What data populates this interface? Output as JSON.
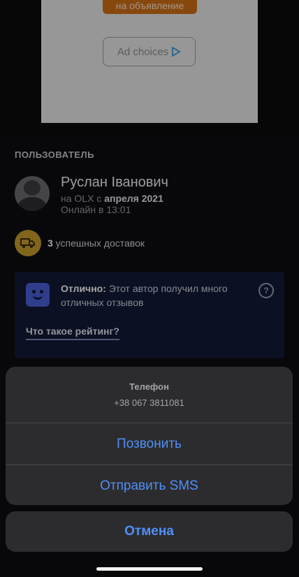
{
  "ad": {
    "report_label": "на объявление",
    "choices_label": "Ad choices"
  },
  "user_section": {
    "title": "ПОЛЬЗОВАТЕЛЬ",
    "name": "Руслан Іванович",
    "since_prefix": "на OLX с ",
    "since_date": "апреля 2021",
    "online": "Онлайн в 13:01"
  },
  "delivery": {
    "count": "3",
    "text": " успешных доставок"
  },
  "rating": {
    "headline": "Отлично:",
    "description": " Этот автор получил много отличных отзывов",
    "link": "Что такое рейтинг?"
  },
  "action_sheet": {
    "title": "Телефон",
    "phone": "+38 067 3811081",
    "call_label": "Позвонить",
    "sms_label": "Отправить SMS",
    "cancel_label": "Отмена"
  },
  "colors": {
    "accent": "#4f8ff7",
    "delivery_badge": "#c59b2a",
    "rating_card": "#121a35"
  }
}
